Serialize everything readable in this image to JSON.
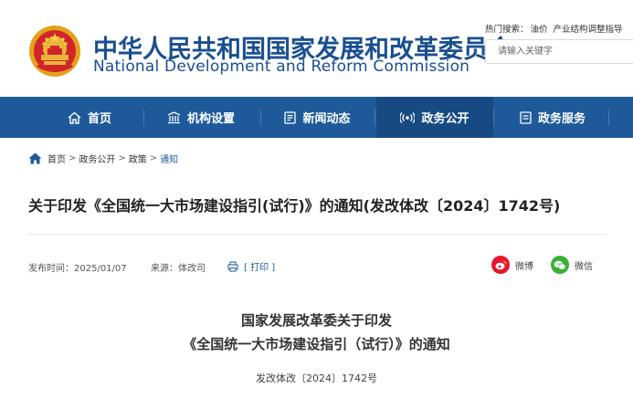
{
  "header": {
    "title_cn": "中华人民共和国国家发展和改革委员会",
    "title_en": "National Development and Reform Commission",
    "hot_search_label": "热门搜索：",
    "hot_keywords": [
      "油价",
      "产业结构调整指导"
    ],
    "search_placeholder": "请输入关键字"
  },
  "nav": {
    "items": [
      {
        "label": "首页",
        "icon": "home-icon"
      },
      {
        "label": "机构设置",
        "icon": "building-icon"
      },
      {
        "label": "新闻动态",
        "icon": "news-icon"
      },
      {
        "label": "政务公开",
        "icon": "broadcast-icon",
        "active": true
      },
      {
        "label": "政务服务",
        "icon": "service-icon"
      }
    ]
  },
  "breadcrumb": {
    "items": [
      "首页",
      "政务公开",
      "政策",
      "通知"
    ],
    "separator": ">"
  },
  "article": {
    "title": "关于印发《全国统一大市场建设指引(试行)》的通知(发改体改〔2024〕1742号)",
    "publish_label": "发布时间：2025/01/07",
    "source_label": "来源：体改司",
    "print_label": "[ 打印 ]",
    "share": [
      {
        "label": "微博",
        "icon": "weibo-icon",
        "color": "#e6162d"
      },
      {
        "label": "微信",
        "icon": "wechat-icon",
        "color": "#3cb034"
      }
    ],
    "doc_heading_line1": "国家发展改革委关于印发",
    "doc_heading_line2": "《全国统一大市场建设指引（试行）》的通知",
    "doc_number": "发改体改〔2024〕1742号"
  },
  "colors": {
    "brand_blue": "#1e5a99",
    "nav_active": "#174a82",
    "title_blue": "#1a4f8f"
  }
}
